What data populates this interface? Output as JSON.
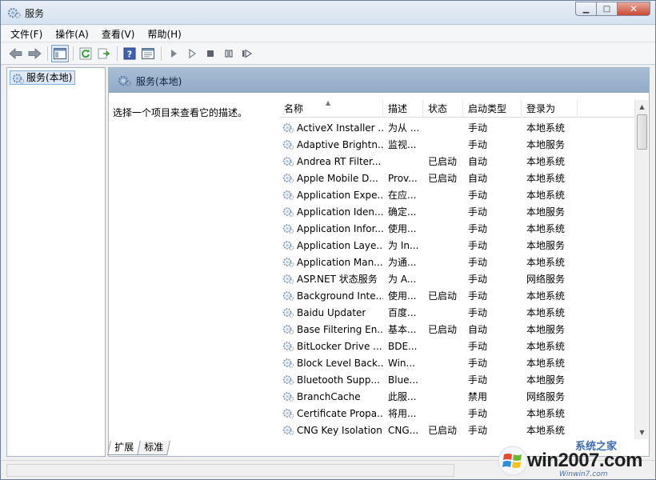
{
  "window": {
    "title": "服务",
    "controls": {
      "minimize": "▁",
      "maximize": "□",
      "close": "✕"
    }
  },
  "menu": [
    "文件(F)",
    "操作(A)",
    "查看(V)",
    "帮助(H)"
  ],
  "toolbar_icons": [
    "back-icon",
    "forward-icon",
    "console-tree-icon",
    "refresh-icon",
    "export-icon",
    "help-icon",
    "properties-icon",
    "start-service-icon",
    "start-service-icon",
    "stop-service-icon",
    "pause-service-icon",
    "resume-service-icon"
  ],
  "tree": {
    "selected": "服务(本地)"
  },
  "pane": {
    "title": "服务(本地)",
    "description": "选择一个项目来查看它的描述。",
    "tabs": [
      "扩展",
      "标准"
    ]
  },
  "table": {
    "columns": [
      "名称",
      "描述",
      "状态",
      "启动类型",
      "登录为"
    ],
    "rows": [
      [
        "ActiveX Installer ...",
        "为从 ...",
        "",
        "手动",
        "本地系统"
      ],
      [
        "Adaptive Brightn...",
        "监视...",
        "",
        "手动",
        "本地服务"
      ],
      [
        "Andrea RT Filter...",
        "",
        "已启动",
        "自动",
        "本地系统"
      ],
      [
        "Apple Mobile D...",
        "Prov...",
        "已启动",
        "自动",
        "本地系统"
      ],
      [
        "Application Expe...",
        "在应...",
        "",
        "手动",
        "本地系统"
      ],
      [
        "Application Iden...",
        "确定...",
        "",
        "手动",
        "本地服务"
      ],
      [
        "Application Infor...",
        "使用...",
        "",
        "手动",
        "本地系统"
      ],
      [
        "Application Laye...",
        "为 In...",
        "",
        "手动",
        "本地服务"
      ],
      [
        "Application Man...",
        "为通...",
        "",
        "手动",
        "本地系统"
      ],
      [
        "ASP.NET 状态服务",
        "为 A...",
        "",
        "手动",
        "网络服务"
      ],
      [
        "Background Inte...",
        "使用...",
        "已启动",
        "手动",
        "本地系统"
      ],
      [
        "Baidu Updater",
        "百度...",
        "",
        "手动",
        "本地系统"
      ],
      [
        "Base Filtering En...",
        "基本...",
        "已启动",
        "自动",
        "本地服务"
      ],
      [
        "BitLocker Drive ...",
        "BDE...",
        "",
        "手动",
        "本地系统"
      ],
      [
        "Block Level Back...",
        "Win...",
        "",
        "手动",
        "本地系统"
      ],
      [
        "Bluetooth Supp...",
        "Blue...",
        "",
        "手动",
        "本地服务"
      ],
      [
        "BranchCache",
        "此服...",
        "",
        "禁用",
        "网络服务"
      ],
      [
        "Certificate Propa...",
        "将用...",
        "",
        "手动",
        "本地系统"
      ],
      [
        "CNG Key Isolation",
        "CNG...",
        "已启动",
        "手动",
        "本地系统"
      ]
    ]
  },
  "watermark": {
    "top": "系统之家",
    "main": "win2007.com",
    "sub": "Winwin7.com"
  }
}
